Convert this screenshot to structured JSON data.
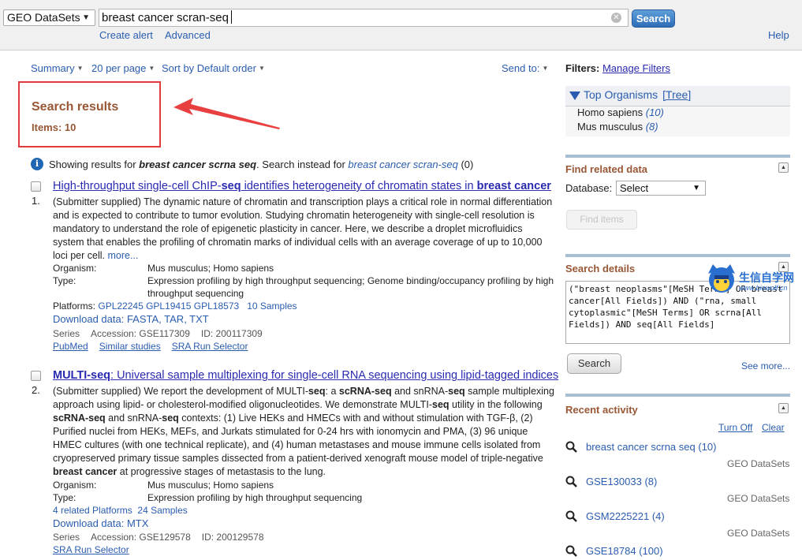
{
  "topbar": {
    "database": "GEO DataSets",
    "query": "breast cancer scran-seq",
    "search_label": "Search",
    "create_alert": "Create alert",
    "advanced": "Advanced",
    "help": "Help"
  },
  "toolbar": {
    "summary": "Summary",
    "per_page": "20 per page",
    "sort": "Sort by Default order",
    "send_to": "Send to:"
  },
  "results": {
    "title": "Search results",
    "items": "Items: 10"
  },
  "showing": {
    "prefix": "Showing results for ",
    "term": "breast cancer scrna seq",
    "middle": ". Search instead for ",
    "alt": "breast cancer scran-seq",
    "suffix": " (0)"
  },
  "entries": [
    {
      "num": "1.",
      "title_plain_a": "High-throughput single-cell ChIP-",
      "title_bold_a": "seq",
      "title_plain_b": " identifies heterogeneity of chromatin states in ",
      "title_bold_b": "breast cancer",
      "desc": "(Submitter supplied) The dynamic nature of chromatin and transcription plays a critical role in normal differentiation and is expected to contribute to tumor evolution. Studying chromatin heterogeneity with single-cell resolution is mandatory to understand the role of epigenetic plasticity in cancer. Here, we describe a droplet microfluidics system that enables the profiling of chromatin marks of individual cells with an average coverage of up to 10,000 loci per cell.",
      "more": "more...",
      "organism_label": "Organism:",
      "organism": "Mus musculus; Homo sapiens",
      "type_label": "Type:",
      "type": "Expression profiling by high throughput sequencing; Genome binding/occupancy profiling by high throughput sequencing",
      "platforms_label": "Platforms: ",
      "platforms": "GPL22245 GPL19415 GPL18573",
      "samples": "10 Samples",
      "download": "Download data: FASTA, TAR, TXT",
      "series": "Series",
      "accession": "Accession: GSE117309",
      "id": "ID: 200117309",
      "link1": "PubMed",
      "link2": "Similar studies",
      "link3": "SRA Run Selector"
    },
    {
      "num": "2.",
      "title_bold_a": "MULTI-seq",
      "title_plain_a": ": Universal sample multiplexing for single-cell RNA sequencing using lipid-tagged indices",
      "desc_a": "(Submitter supplied) We report the development of MULTI-",
      "desc_b": "seq",
      "desc_c": ": a ",
      "desc_d": "scRNA-seq",
      "desc_e": " and snRNA-",
      "desc_f": "seq",
      "desc_g": " sample multiplexing approach using lipid- or cholesterol-modified oligonucleotides. We demonstrate MULTI-",
      "desc_h": "seq",
      "desc_i": " utility in the following ",
      "desc_j": "scRNA-seq",
      "desc_k": " and snRNA-",
      "desc_l": "seq",
      "desc_m": " contexts: (1) Live HEKs and HMECs with and without stimulation with TGF-β, (2) Purified nuclei from HEKs, MEFs, and Jurkats stimulated for 0-24 hrs with ionomycin and PMA, (3) 96 unique HMEC cultures (with one technical replicate), and (4) human metastases and mouse immune cells isolated from cryopreserved primary tissue samples dissected from a patient-derived xenograft mouse model of triple-negative ",
      "desc_n": "breast cancer",
      "desc_o": " at progressive stages of metastasis to the lung.",
      "organism_label": "Organism:",
      "organism": "Mus musculus; Homo sapiens",
      "type_label": "Type:",
      "type": "Expression profiling by high throughput sequencing",
      "platforms": "4 related Platforms",
      "samples": "24 Samples",
      "download": "Download data: MTX",
      "series": "Series",
      "accession": "Accession: GSE129578",
      "id": "ID: 200129578",
      "link1": "SRA Run Selector"
    }
  ],
  "sidebar": {
    "filters_label": "Filters:",
    "manage_filters": "Manage Filters",
    "top_organisms": "Top Organisms",
    "tree": "[Tree]",
    "organisms": [
      {
        "name": "Homo sapiens",
        "count": "(10)"
      },
      {
        "name": "Mus musculus",
        "count": "(8)"
      }
    ],
    "find_related": "Find related data",
    "database_label": "Database:",
    "database_select": "Select",
    "find_items": "Find items",
    "search_details": "Search details",
    "details_query": "(\"breast neoplasms\"[MeSH Terms] OR breast cancer[All Fields]) AND (\"rna, small cytoplasmic\"[MeSH Terms] OR scrna[All Fields]) AND seq[All Fields]",
    "search_label": "Search",
    "see_more": "See more...",
    "recent_activity": "Recent activity",
    "turn_off": "Turn Off",
    "clear": "Clear",
    "recent": [
      {
        "query": "breast cancer scrna seq (10)",
        "db": "GEO DataSets"
      },
      {
        "query": "GSE130033 (8)",
        "db": "GEO DataSets"
      },
      {
        "query": "GSM2225221 (4)",
        "db": "GEO DataSets"
      },
      {
        "query": "GSE18784 (100)",
        "db": ""
      }
    ]
  },
  "watermark": {
    "title": "生信自学网",
    "url": "www.biowolf.cn"
  },
  "colors": {
    "accent": "#2e6db7",
    "heading": "#985735",
    "highlight_box": "#e23b3b",
    "link": "#2a5db0"
  }
}
